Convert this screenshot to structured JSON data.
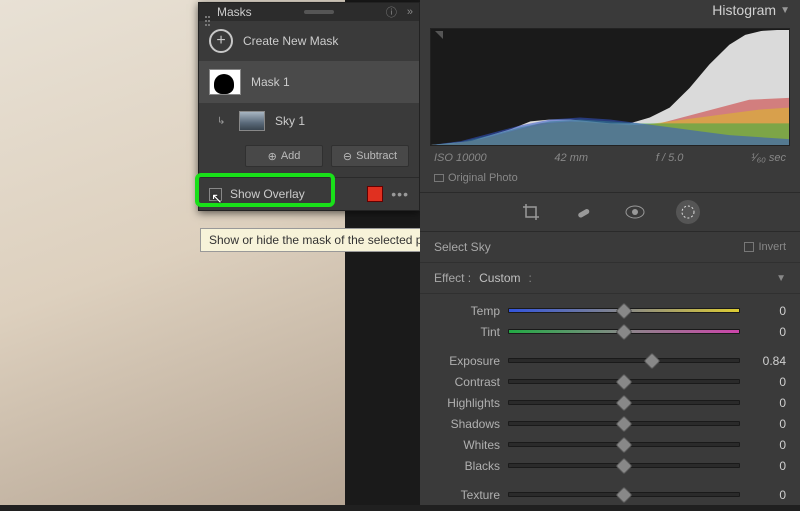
{
  "photo": {},
  "masks_panel": {
    "title": "Masks",
    "create_label": "Create New Mask",
    "mask1_label": "Mask 1",
    "sky1_label": "Sky 1",
    "add_label": "Add",
    "subtract_label": "Subtract",
    "show_overlay_label": "Show Overlay",
    "overlay_color": "#e03020",
    "tooltip": "Show or hide the mask of the selected pin (O)"
  },
  "right_panel": {
    "header": "Histogram",
    "meta": {
      "iso": "ISO 10000",
      "focal": "42 mm",
      "aperture": "f / 5.0",
      "shutter": "¹⁄₆₀ sec"
    },
    "original_label": "Original Photo",
    "section_title": "Select Sky",
    "invert_label": "Invert",
    "effect_label": "Effect :",
    "effect_value": "Custom",
    "sliders": [
      {
        "label": "Temp",
        "value": "0",
        "pos": 50,
        "cls": "temp"
      },
      {
        "label": "Tint",
        "value": "0",
        "pos": 50,
        "cls": "tint"
      },
      {
        "label": "",
        "value": "",
        "pos": null,
        "cls": "gap"
      },
      {
        "label": "Exposure",
        "value": "0.84",
        "pos": 62,
        "cls": ""
      },
      {
        "label": "Contrast",
        "value": "0",
        "pos": 50,
        "cls": ""
      },
      {
        "label": "Highlights",
        "value": "0",
        "pos": 50,
        "cls": ""
      },
      {
        "label": "Shadows",
        "value": "0",
        "pos": 50,
        "cls": ""
      },
      {
        "label": "Whites",
        "value": "0",
        "pos": 50,
        "cls": ""
      },
      {
        "label": "Blacks",
        "value": "0",
        "pos": 50,
        "cls": ""
      },
      {
        "label": "",
        "value": "",
        "pos": null,
        "cls": "gap"
      },
      {
        "label": "Texture",
        "value": "0",
        "pos": 50,
        "cls": ""
      }
    ]
  }
}
